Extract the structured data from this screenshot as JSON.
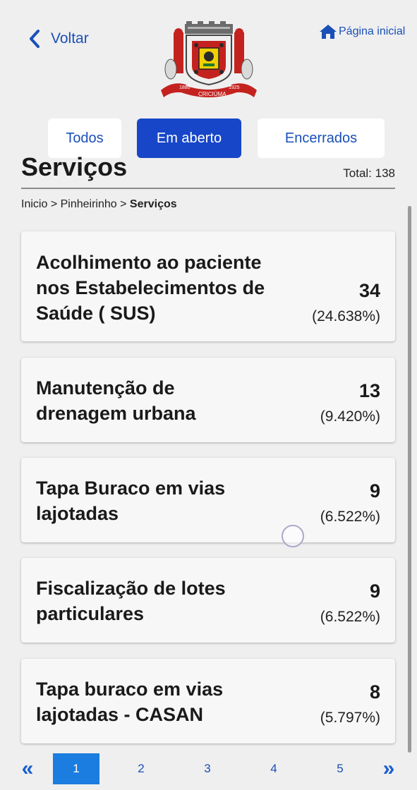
{
  "header": {
    "back_label": "Voltar",
    "home_label": "Página inicial",
    "crest_years": [
      "1880",
      "1925"
    ],
    "crest_city": "CRICIÚMA"
  },
  "filters": {
    "todos": "Todos",
    "em_aberto": "Em aberto",
    "encerrados": "Encerrados",
    "active": "Em aberto"
  },
  "page": {
    "title": "Serviços",
    "total": "Total: 138"
  },
  "breadcrumb": {
    "inicio": "Inicio",
    "sep1": ">",
    "bairro": "Pinheirinho",
    "sep2": ">",
    "current": "Serviços"
  },
  "services": [
    {
      "line1": "Acolhimento ao paciente",
      "line2": "nos Estabelecimentos de",
      "line3": "Saúde ( SUS)",
      "count": "34",
      "percent": "(24.638%)"
    },
    {
      "line1": "Manutenção de",
      "line2": "drenagem urbana",
      "line3": "",
      "count": "13",
      "percent": "(9.420%)"
    },
    {
      "line1": "Tapa Buraco em vias",
      "line2": "lajotadas",
      "line3": "",
      "count": "9",
      "percent": "(6.522%)"
    },
    {
      "line1": "Fiscalização de lotes",
      "line2": "particulares",
      "line3": "",
      "count": "9",
      "percent": "(6.522%)"
    },
    {
      "line1": "Tapa buraco em vias",
      "line2": "lajotadas - CASAN",
      "line3": "",
      "count": "8",
      "percent": "(5.797%)"
    }
  ],
  "pagination": {
    "prev": "«",
    "pages": [
      "1",
      "2",
      "3",
      "4",
      "5"
    ],
    "current": "1",
    "next": "»"
  },
  "colors": {
    "accent": "#1746c8",
    "link": "#1a4fb8",
    "page_active": "#1b7de0",
    "background": "#efefef"
  },
  "icons": {
    "back": "chevron-left-icon",
    "home": "house-icon",
    "crest": "city-coat-of-arms"
  }
}
